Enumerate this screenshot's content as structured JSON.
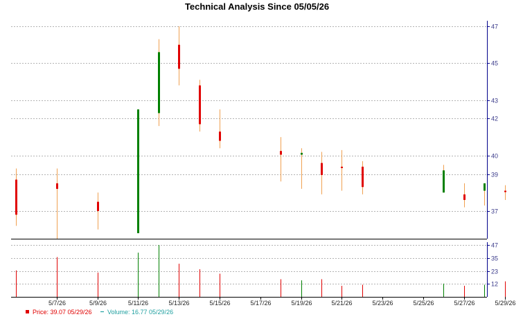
{
  "chart_data": {
    "type": "candlestick",
    "title": "Technical Analysis Since 05/05/26",
    "price_axis": {
      "ylim": [
        35.5,
        47
      ],
      "ticks": [
        37,
        39,
        40,
        42,
        43,
        45,
        47
      ]
    },
    "volume_axis": {
      "ylim": [
        0,
        47
      ],
      "ticks": [
        12,
        23,
        35,
        47
      ]
    },
    "x_axis": {
      "start": "5/5/26",
      "end": "5/30/26",
      "ticks": [
        "5/7/26",
        "5/9/26",
        "5/11/26",
        "5/13/26",
        "5/15/26",
        "5/17/26",
        "5/19/26",
        "5/21/26",
        "5/23/26",
        "5/25/26",
        "5/27/26",
        "5/29/26"
      ]
    },
    "grid": true,
    "colors": {
      "up": "#008000",
      "down": "#e00000",
      "wick": "#f0a050",
      "axis": "#00008b",
      "grid": "#999999",
      "volume_text": "#20a0a0"
    },
    "candles": [
      {
        "date": "5/5/26",
        "open": 38.7,
        "high": 39.3,
        "low": 36.2,
        "close": 36.8,
        "volume": 24
      },
      {
        "date": "5/7/26",
        "open": 38.5,
        "high": 39.3,
        "low": 35.5,
        "close": 38.2,
        "volume": 36
      },
      {
        "date": "5/9/26",
        "open": 37.5,
        "high": 38.0,
        "low": 36.0,
        "close": 37.0,
        "volume": 22
      },
      {
        "date": "5/11/26",
        "open": 35.8,
        "high": 42.5,
        "low": 35.8,
        "close": 42.5,
        "volume": 40
      },
      {
        "date": "5/12/26",
        "open": 42.3,
        "high": 46.3,
        "low": 41.6,
        "close": 45.6,
        "volume": 47
      },
      {
        "date": "5/13/26",
        "open": 46.0,
        "high": 47.0,
        "low": 43.8,
        "close": 44.7,
        "volume": 30
      },
      {
        "date": "5/14/26",
        "open": 43.8,
        "high": 44.1,
        "low": 41.3,
        "close": 41.7,
        "volume": 25
      },
      {
        "date": "5/15/26",
        "open": 41.3,
        "high": 42.5,
        "low": 40.4,
        "close": 40.8,
        "volume": 21
      },
      {
        "date": "5/18/26",
        "open": 40.25,
        "high": 41.0,
        "low": 38.6,
        "close": 40.05,
        "volume": 16
      },
      {
        "date": "5/19/26",
        "open": 40.05,
        "high": 40.4,
        "low": 38.2,
        "close": 40.15,
        "volume": 15
      },
      {
        "date": "5/20/26",
        "open": 39.6,
        "high": 40.2,
        "low": 37.9,
        "close": 38.95,
        "volume": 16
      },
      {
        "date": "5/21/26",
        "open": 39.4,
        "high": 40.3,
        "low": 38.1,
        "close": 39.35,
        "volume": 10
      },
      {
        "date": "5/22/26",
        "open": 39.4,
        "high": 39.7,
        "low": 37.9,
        "close": 38.3,
        "volume": 11
      },
      {
        "date": "5/26/26",
        "open": 38.0,
        "high": 39.5,
        "low": 38.0,
        "close": 39.2,
        "volume": 12
      },
      {
        "date": "5/27/26",
        "open": 37.9,
        "high": 38.5,
        "low": 37.2,
        "close": 37.6,
        "volume": 10
      },
      {
        "date": "5/28/26",
        "open": 38.1,
        "high": 38.5,
        "low": 37.3,
        "close": 38.5,
        "volume": 11
      },
      {
        "date": "5/29/26",
        "open": 38.1,
        "high": 38.4,
        "low": 37.6,
        "close": 38.05,
        "volume": 14
      }
    ],
    "legend": [
      {
        "label": "Price: 39.07  05/29/26",
        "color": "#e00000",
        "marker": "square"
      },
      {
        "label": "Volume: 16.77  05/29/26",
        "color": "#20a0a0",
        "marker": "dash"
      }
    ]
  }
}
